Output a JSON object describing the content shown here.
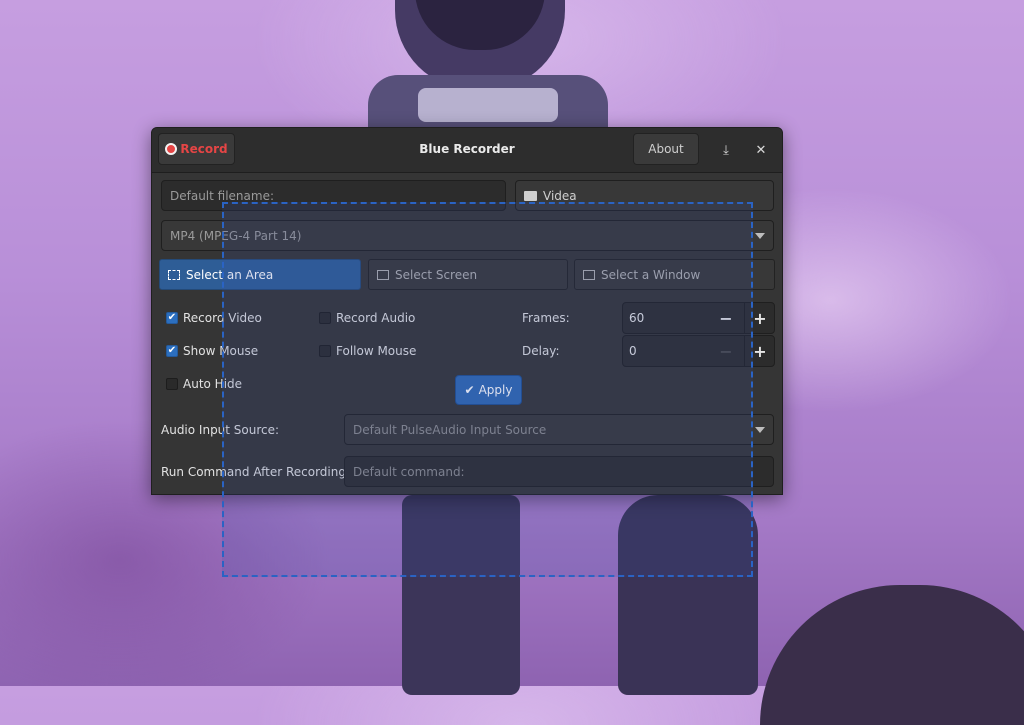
{
  "window": {
    "title": "Blue Recorder",
    "record_label": "Record",
    "about_label": "About",
    "minimize_glyph": "⤓",
    "close_glyph": "✕"
  },
  "filename": {
    "placeholder": "Default filename:"
  },
  "folder": {
    "label": "Videa"
  },
  "format": {
    "selected": "MP4 (MPEG-4 Part 14)"
  },
  "modes": {
    "area": "Select an Area",
    "screen": "Select Screen",
    "window": "Select a Window"
  },
  "options": {
    "record_video": {
      "label": "Record Video",
      "checked": true
    },
    "record_audio": {
      "label": "Record Audio",
      "checked": false
    },
    "show_mouse": {
      "label": "Show Mouse",
      "checked": true
    },
    "follow_mouse": {
      "label": "Follow Mouse",
      "checked": false
    },
    "auto_hide": {
      "label": "Auto Hide",
      "checked": false
    }
  },
  "frames": {
    "label": "Frames:",
    "value": "60"
  },
  "delay": {
    "label": "Delay:",
    "value": "0"
  },
  "apply_label": "Apply",
  "audio_source": {
    "label": "Audio Input Source:",
    "selected": "Default PulseAudio Input Source"
  },
  "command": {
    "label": "Run Command After Recording:",
    "placeholder": "Default command:"
  },
  "colors": {
    "accent": "#2f68b2",
    "record_red": "#e54545",
    "selection_border": "#2a63c4"
  }
}
